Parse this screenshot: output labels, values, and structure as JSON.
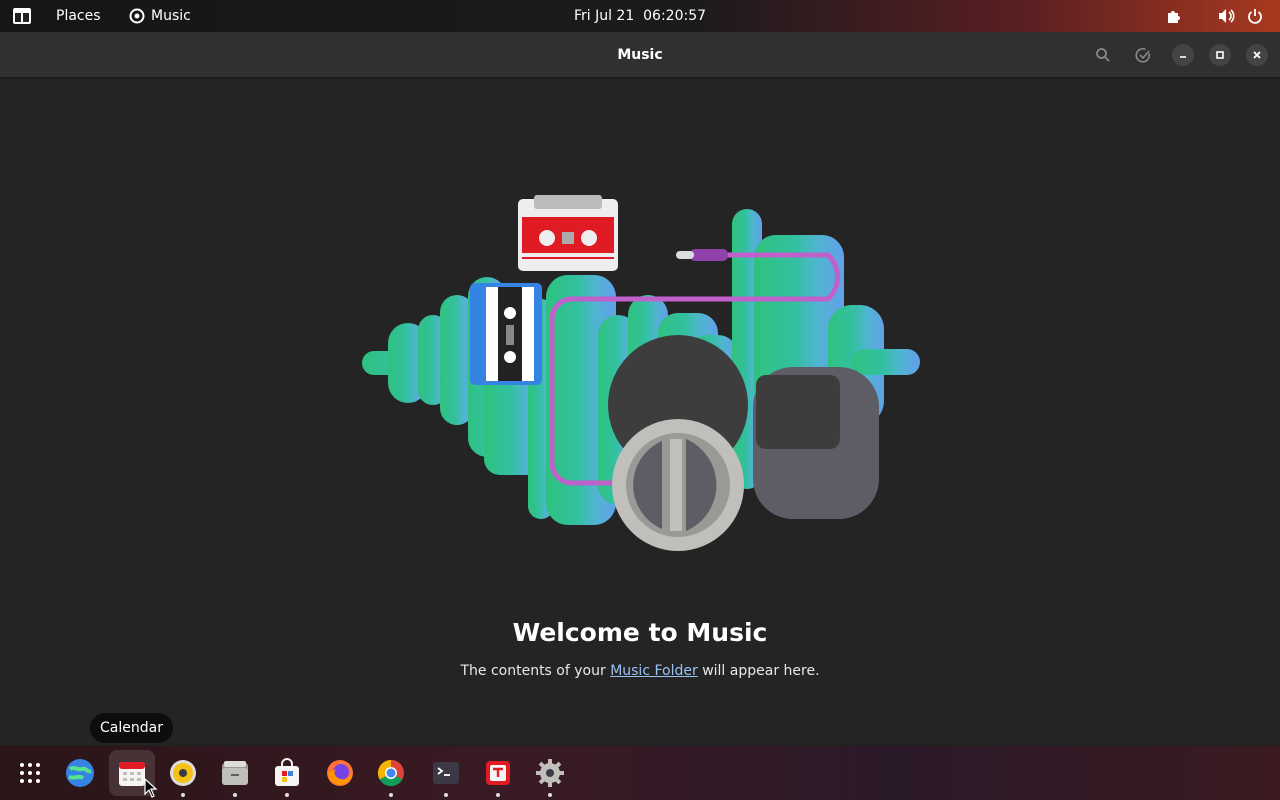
{
  "topbar": {
    "places_label": "Places",
    "app_label": "Music",
    "clock": "Fri Jul 21  06:20:57"
  },
  "window": {
    "title": "Music"
  },
  "main": {
    "welcome_title": "Welcome to Music",
    "subtitle_before": "The contents of your ",
    "subtitle_link": "Music Folder",
    "subtitle_after": " will appear here."
  },
  "tooltip": {
    "label": "Calendar"
  },
  "dock": {
    "items": [
      {
        "icon": "app-grid-icon",
        "running": false
      },
      {
        "icon": "browser-globe-icon",
        "running": false
      },
      {
        "icon": "calendar-icon",
        "running": false
      },
      {
        "icon": "rhythmbox-icon",
        "running": true
      },
      {
        "icon": "files-icon",
        "running": true
      },
      {
        "icon": "software-icon",
        "running": true
      },
      {
        "icon": "firefox-icon",
        "running": false
      },
      {
        "icon": "chrome-icon",
        "running": true
      },
      {
        "icon": "terminal-icon",
        "running": true
      },
      {
        "icon": "text-editor-icon",
        "running": true
      },
      {
        "icon": "settings-icon",
        "running": true
      }
    ]
  },
  "colors": {
    "accent_link": "#99c1f1",
    "window_bg": "#242424",
    "header_bg": "#303030"
  }
}
